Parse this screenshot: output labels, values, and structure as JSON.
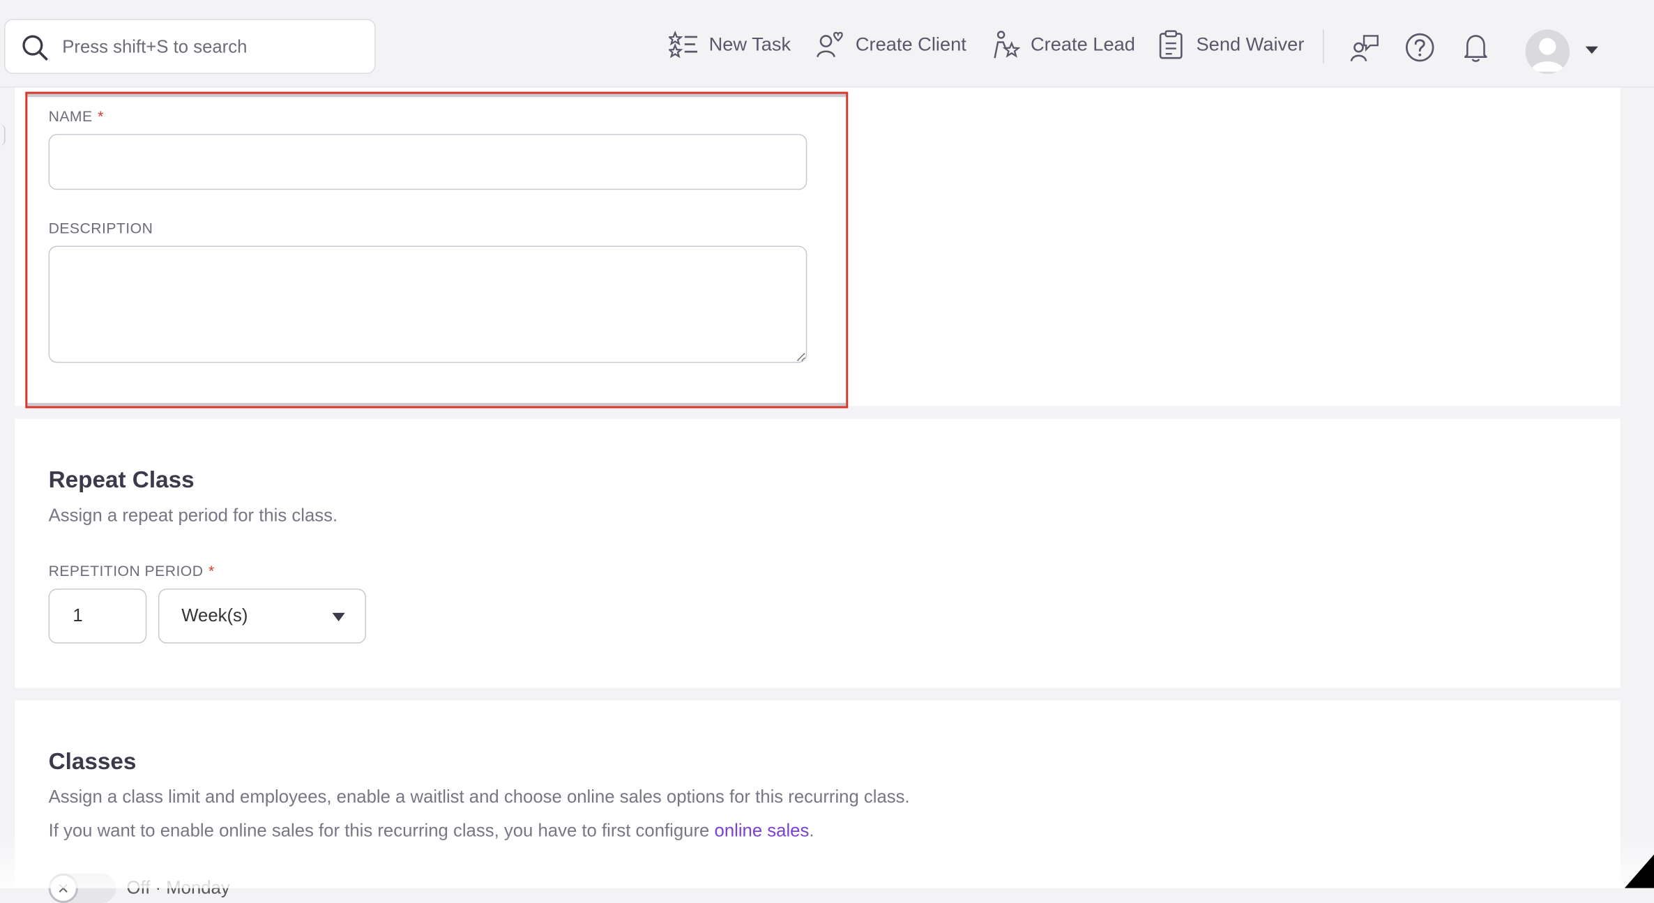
{
  "header": {
    "search_placeholder": "Press shift+S to search",
    "actions": {
      "new_task": "New Task",
      "create_client": "Create Client",
      "create_lead": "Create Lead",
      "send_waiver": "Send Waiver"
    }
  },
  "details": {
    "name_label": "NAME",
    "required_marker": "*",
    "name_value": "",
    "description_label": "DESCRIPTION",
    "description_value": ""
  },
  "repeat": {
    "title": "Repeat Class",
    "description": "Assign a repeat period for this class.",
    "period_label": "REPETITION PERIOD",
    "period_count": "1",
    "period_unit": "Week(s)"
  },
  "classes": {
    "title": "Classes",
    "description": "Assign a class limit and employees, enable a waitlist and choose online sales options for this recurring class.",
    "online_text": "If you want to enable online sales for this recurring class, you have to first configure",
    "online_link": "online sales",
    "online_end": ".",
    "toggle_knob": "✕",
    "toggle_label": "Off · Monday"
  },
  "colors": {
    "accent_link": "#7b3fd3",
    "required": "#d6392c",
    "highlight_border": "#d6392c"
  }
}
